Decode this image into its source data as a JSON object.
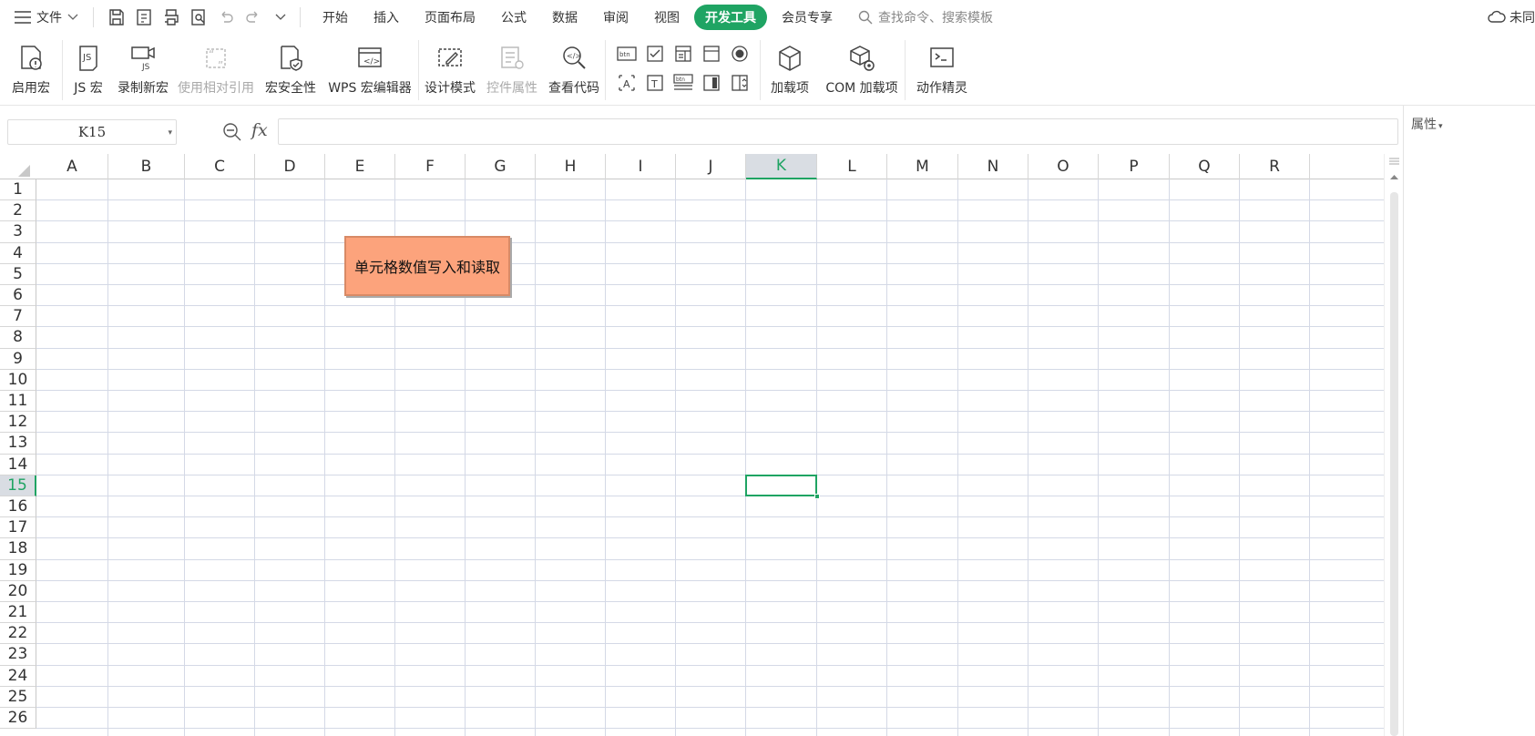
{
  "topbar": {
    "file_label": "文件",
    "tabs": [
      {
        "label": "开始",
        "active": false
      },
      {
        "label": "插入",
        "active": false
      },
      {
        "label": "页面布局",
        "active": false
      },
      {
        "label": "公式",
        "active": false
      },
      {
        "label": "数据",
        "active": false
      },
      {
        "label": "审阅",
        "active": false
      },
      {
        "label": "视图",
        "active": false
      },
      {
        "label": "开发工具",
        "active": true
      },
      {
        "label": "会员专享",
        "active": false
      }
    ],
    "search_placeholder": "查找命令、搜索模板",
    "sync_label": "未同"
  },
  "ribbon": {
    "enable_macro": "启用宏",
    "js_macro": "JS 宏",
    "record_macro": "录制新宏",
    "relative_ref": "使用相对引用",
    "macro_security": "宏安全性",
    "wps_macro_editor": "WPS 宏编辑器",
    "design_mode": "设计模式",
    "control_props": "控件属性",
    "view_code": "查看代码",
    "addins": "加载项",
    "com_addins": "COM 加载项",
    "action_wizard": "动作精灵"
  },
  "formula_bar": {
    "name_box": "K15",
    "fx_label": "fx",
    "formula_value": ""
  },
  "props_panel": {
    "title": "属性"
  },
  "sheet": {
    "columns": [
      "A",
      "B",
      "C",
      "D",
      "E",
      "F",
      "G",
      "H",
      "I",
      "J",
      "K",
      "L",
      "M",
      "N",
      "O",
      "P",
      "Q",
      "R"
    ],
    "rows": [
      "1",
      "2",
      "3",
      "4",
      "5",
      "6",
      "7",
      "8",
      "9",
      "10",
      "11",
      "12",
      "13",
      "14",
      "15",
      "16",
      "17",
      "18",
      "19",
      "20",
      "21",
      "22",
      "23",
      "24",
      "25",
      "26"
    ],
    "selected_column": "K",
    "selected_row": "15",
    "macro_button_label": "单元格数值写入和读取"
  },
  "colors": {
    "accent": "#1fa463",
    "macro_button": "#fca37c",
    "grid_line": "#d4d9e6"
  }
}
